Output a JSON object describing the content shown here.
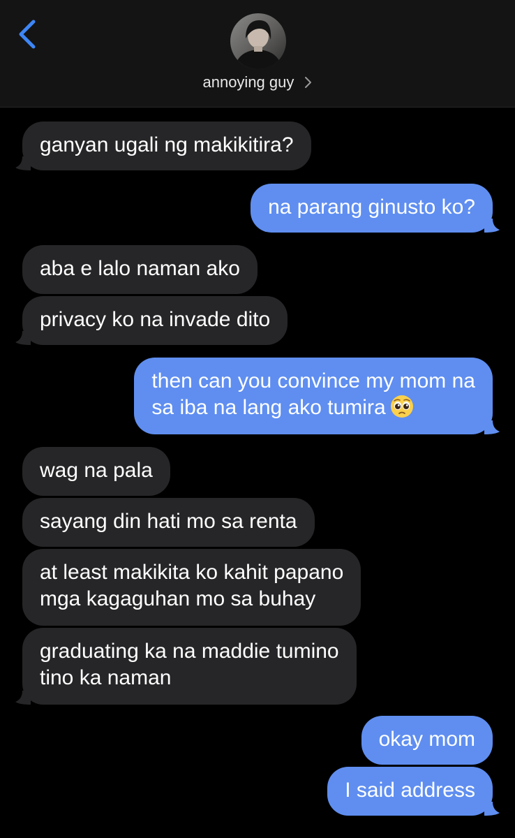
{
  "header": {
    "back_icon": "chevron-left-icon",
    "contact_name": "annoying guy",
    "chevron_icon": "chevron-right-icon",
    "accent_color": "#3e86f6"
  },
  "messages": [
    {
      "direction": "incoming",
      "text": "ganyan ugali ng makikitira?"
    },
    {
      "direction": "outgoing",
      "text": "na parang ginusto ko?"
    },
    {
      "direction": "incoming",
      "text": "aba e lalo naman ako"
    },
    {
      "direction": "incoming",
      "text": "privacy ko na invade dito"
    },
    {
      "direction": "outgoing",
      "line1": "then can you convince my mom na",
      "line2": "sa iba na lang ako tumira",
      "emoji": "pleading-face-emoji"
    },
    {
      "direction": "incoming",
      "text": "wag na pala"
    },
    {
      "direction": "incoming",
      "text": "sayang din hati mo sa renta"
    },
    {
      "direction": "incoming",
      "line1": "at least makikita ko kahit papano",
      "line2": "mga kagaguhan mo sa buhay"
    },
    {
      "direction": "incoming",
      "line1": "graduating ka na maddie tumino",
      "line2": "tino ka naman"
    },
    {
      "direction": "outgoing",
      "text": "okay mom"
    },
    {
      "direction": "outgoing",
      "text": "I said address"
    }
  ],
  "colors": {
    "incoming_bubble": "#262628",
    "outgoing_bubble": "#5f8ef0",
    "background": "#000000",
    "header_background": "#141414"
  }
}
